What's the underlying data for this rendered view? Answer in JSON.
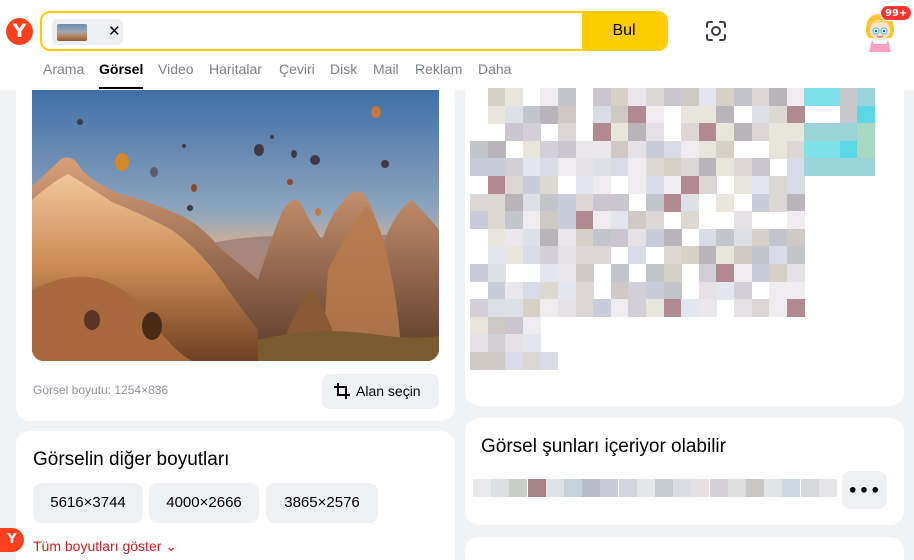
{
  "header": {
    "logo_letter": "Y",
    "search_button": "Bul",
    "chip_close": "✕",
    "notification_badge": "99+"
  },
  "tabs": [
    {
      "label": "Arama",
      "active": false
    },
    {
      "label": "Görsel",
      "active": true
    },
    {
      "label": "Video",
      "active": false
    },
    {
      "label": "Haritalar",
      "active": false
    },
    {
      "label": "Çeviri",
      "active": false
    },
    {
      "label": "Disk",
      "active": false
    },
    {
      "label": "Mail",
      "active": false
    },
    {
      "label": "Reklam",
      "active": false
    },
    {
      "label": "Daha",
      "active": false
    }
  ],
  "image_card": {
    "size_text": "Görsel boyutu: 1254×836",
    "crop_button": "Alan seçin"
  },
  "sizes_card": {
    "title": "Görselin diğer boyutları",
    "sizes": [
      "5616×3744",
      "4000×2666",
      "3865×2576"
    ],
    "show_all": "Tüm boyutları göster ⌄"
  },
  "contains_card": {
    "title": "Görsel şunları içeriyor olabilir",
    "more_button": "•••"
  },
  "colors": {
    "accent_yellow": "#fecd01",
    "brand_red": "#fc3f1d",
    "link_red": "#cc1f1f"
  },
  "icons": {
    "lens": "camera-lens-icon",
    "crop": "crop-icon"
  }
}
